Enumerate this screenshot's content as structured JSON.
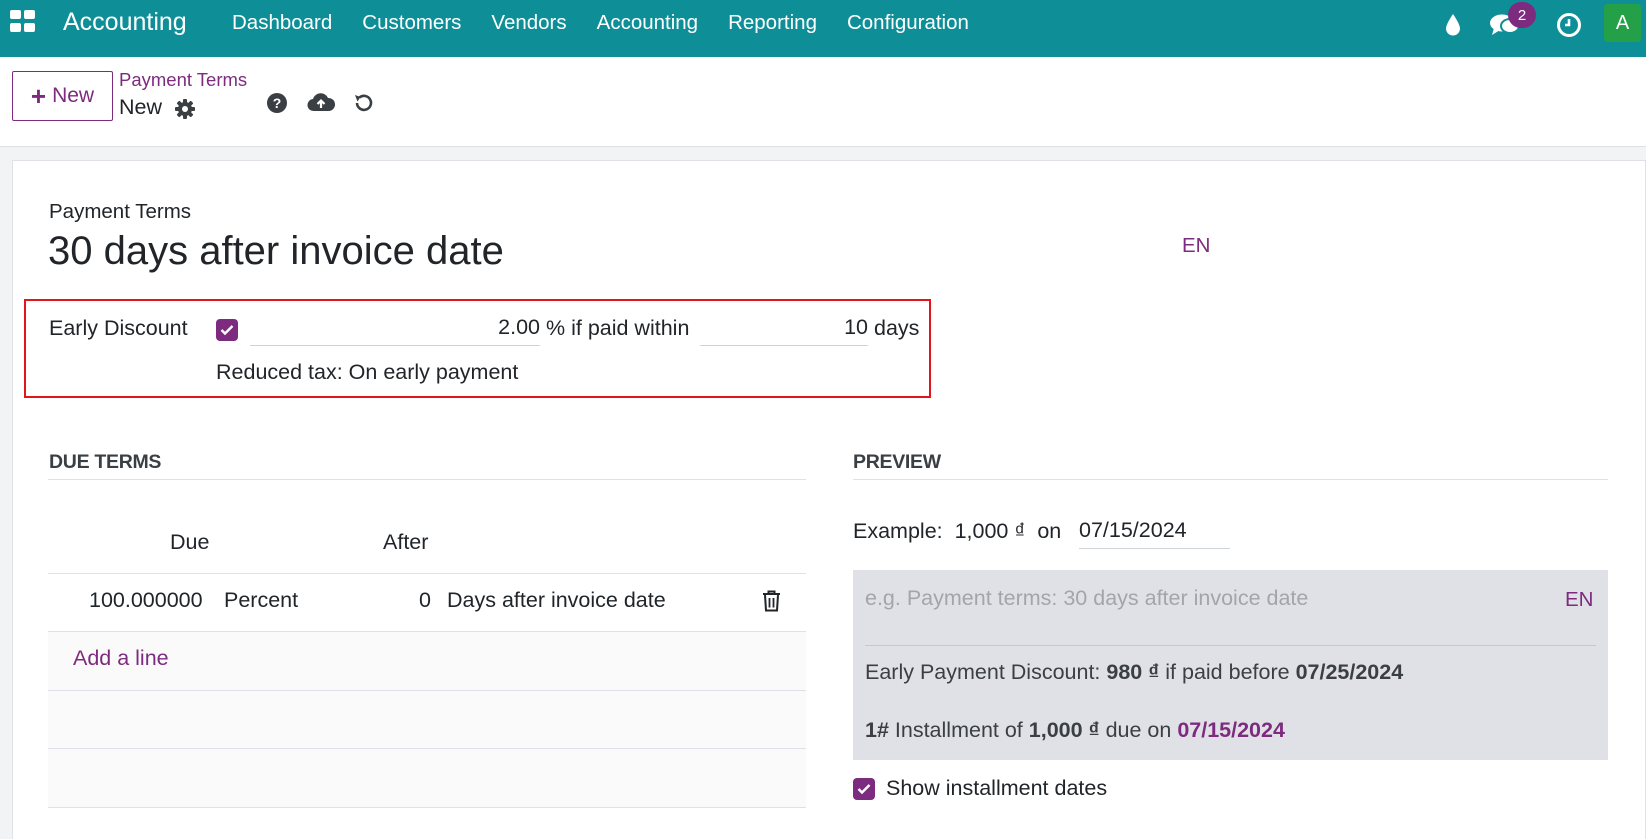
{
  "navbar": {
    "brand": "Accounting",
    "menu": [
      "Dashboard",
      "Customers",
      "Vendors",
      "Accounting",
      "Reporting",
      "Configuration"
    ],
    "message_count": "2",
    "avatar_initial": "A",
    "bg_color": "#0e8f98"
  },
  "control_panel": {
    "new_label": "New",
    "breadcrumb": "Payment Terms",
    "record_name": "New",
    "icons": [
      "gear-icon",
      "help-icon",
      "save-cloud-icon",
      "discard-icon"
    ]
  },
  "form": {
    "small_label": "Payment Terms",
    "title": "30 days after invoice date",
    "lang": "EN",
    "early_discount": {
      "label": "Early Discount",
      "checked": true,
      "percent": "2.00",
      "percent_suffix": "% if paid within",
      "days": "10",
      "days_suffix": "days",
      "reduced_tax": "Reduced tax: On early payment"
    }
  },
  "due_terms": {
    "title": "DUE TERMS",
    "columns": [
      "Due",
      "After"
    ],
    "rows": [
      {
        "due": "100.000000",
        "type": "Percent",
        "after": "0",
        "after_type": "Days after invoice date"
      }
    ],
    "add_line": "Add a line"
  },
  "preview": {
    "title": "PREVIEW",
    "example_label": "Example:",
    "example_amount": "1,000 ₫",
    "example_on": "on",
    "example_date": "07/15/2024",
    "placeholder": "e.g. Payment terms: 30 days after invoice date",
    "lang": "EN",
    "discount_label": "Early Payment Discount:",
    "discount_amount": "980 ₫",
    "discount_mid": "if paid before",
    "discount_date": "07/25/2024",
    "installment_no": "1#",
    "installment_label": "Installment of",
    "installment_amount": "1,000 ₫",
    "installment_mid": "due on",
    "installment_date": "07/15/2024",
    "show_dates_label": "Show installment dates",
    "show_dates_checked": true
  },
  "colors": {
    "accent": "#7d2b7e",
    "highlight": "#e0161b"
  }
}
